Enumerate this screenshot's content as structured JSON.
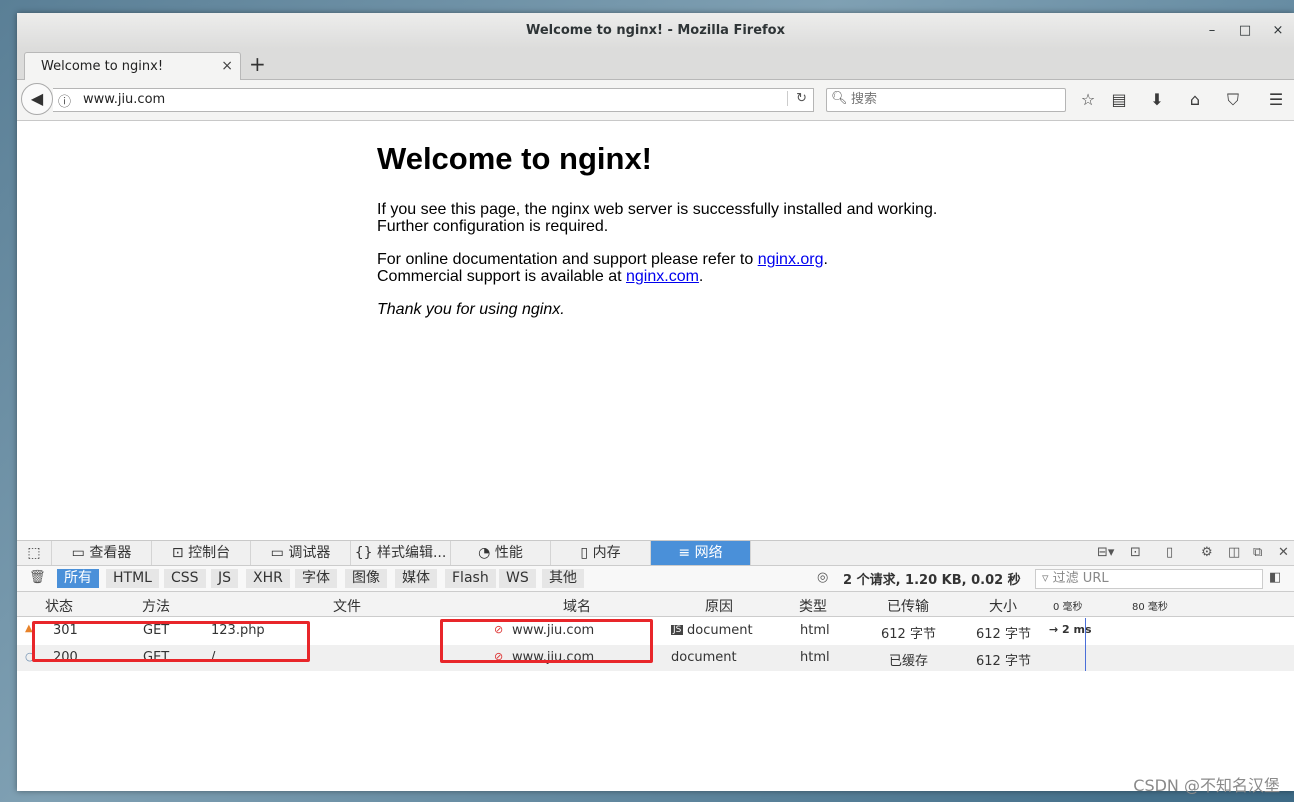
{
  "window": {
    "title": "Welcome to nginx! - Mozilla Firefox",
    "minimize": "–",
    "maximize": "□",
    "close": "×"
  },
  "tabs": [
    {
      "label": "Welcome to nginx!",
      "close": "×"
    }
  ],
  "new_tab": "+",
  "navbar": {
    "url": "www.jiu.com",
    "search_placeholder": "搜索"
  },
  "page": {
    "heading": "Welcome to nginx!",
    "para1_line1": "If you see this page, the nginx web server is successfully installed and working.",
    "para1_line2": "Further configuration is required.",
    "para2_prefix": "For online documentation and support please refer to ",
    "link1": "nginx.org",
    "para2_mid": ".",
    "para2_line2_prefix": "Commercial support is available at ",
    "link2": "nginx.com",
    "para2_end": ".",
    "thanks": "Thank you for using nginx."
  },
  "devtools": {
    "tabs": [
      {
        "label": "查看器",
        "icon": "inspector-icon"
      },
      {
        "label": "控制台",
        "icon": "console-icon"
      },
      {
        "label": "调试器",
        "icon": "debugger-icon"
      },
      {
        "label": "样式编辑...",
        "icon": "style-editor-icon"
      },
      {
        "label": "性能",
        "icon": "performance-icon"
      },
      {
        "label": "内存",
        "icon": "memory-icon"
      },
      {
        "label": "网络",
        "icon": "network-icon"
      }
    ],
    "active_tab": "网络",
    "filters": [
      "所有",
      "HTML",
      "CSS",
      "JS",
      "XHR",
      "字体",
      "图像",
      "媒体",
      "Flash",
      "WS",
      "其他"
    ],
    "active_filter": "所有",
    "summary": "2 个请求, 1.20 KB, 0.02 秒",
    "url_filter_placeholder": "过滤 URL",
    "columns": [
      "状态",
      "方法",
      "文件",
      "域名",
      "原因",
      "类型",
      "已传输",
      "大小"
    ],
    "timeline_ticks": [
      "0 毫秒",
      "80 毫秒"
    ],
    "rows": [
      {
        "status": "301",
        "method": "GET",
        "file": "123.php",
        "domain": "www.jiu.com",
        "cause": "document",
        "type": "html",
        "transferred": "612 字节",
        "size": "612 字节",
        "timing": "→ 2 ms"
      },
      {
        "status": "200",
        "method": "GET",
        "file": "/",
        "domain": "www.jiu.com",
        "cause": "document",
        "type": "html",
        "transferred": "已缓存",
        "size": "612 字节",
        "timing": ""
      }
    ]
  },
  "watermark": "CSDN @不知名汉堡",
  "colors": {
    "active_blue": "#4a90d9",
    "highlight_red": "#e8262a",
    "link": "#0000ee"
  }
}
